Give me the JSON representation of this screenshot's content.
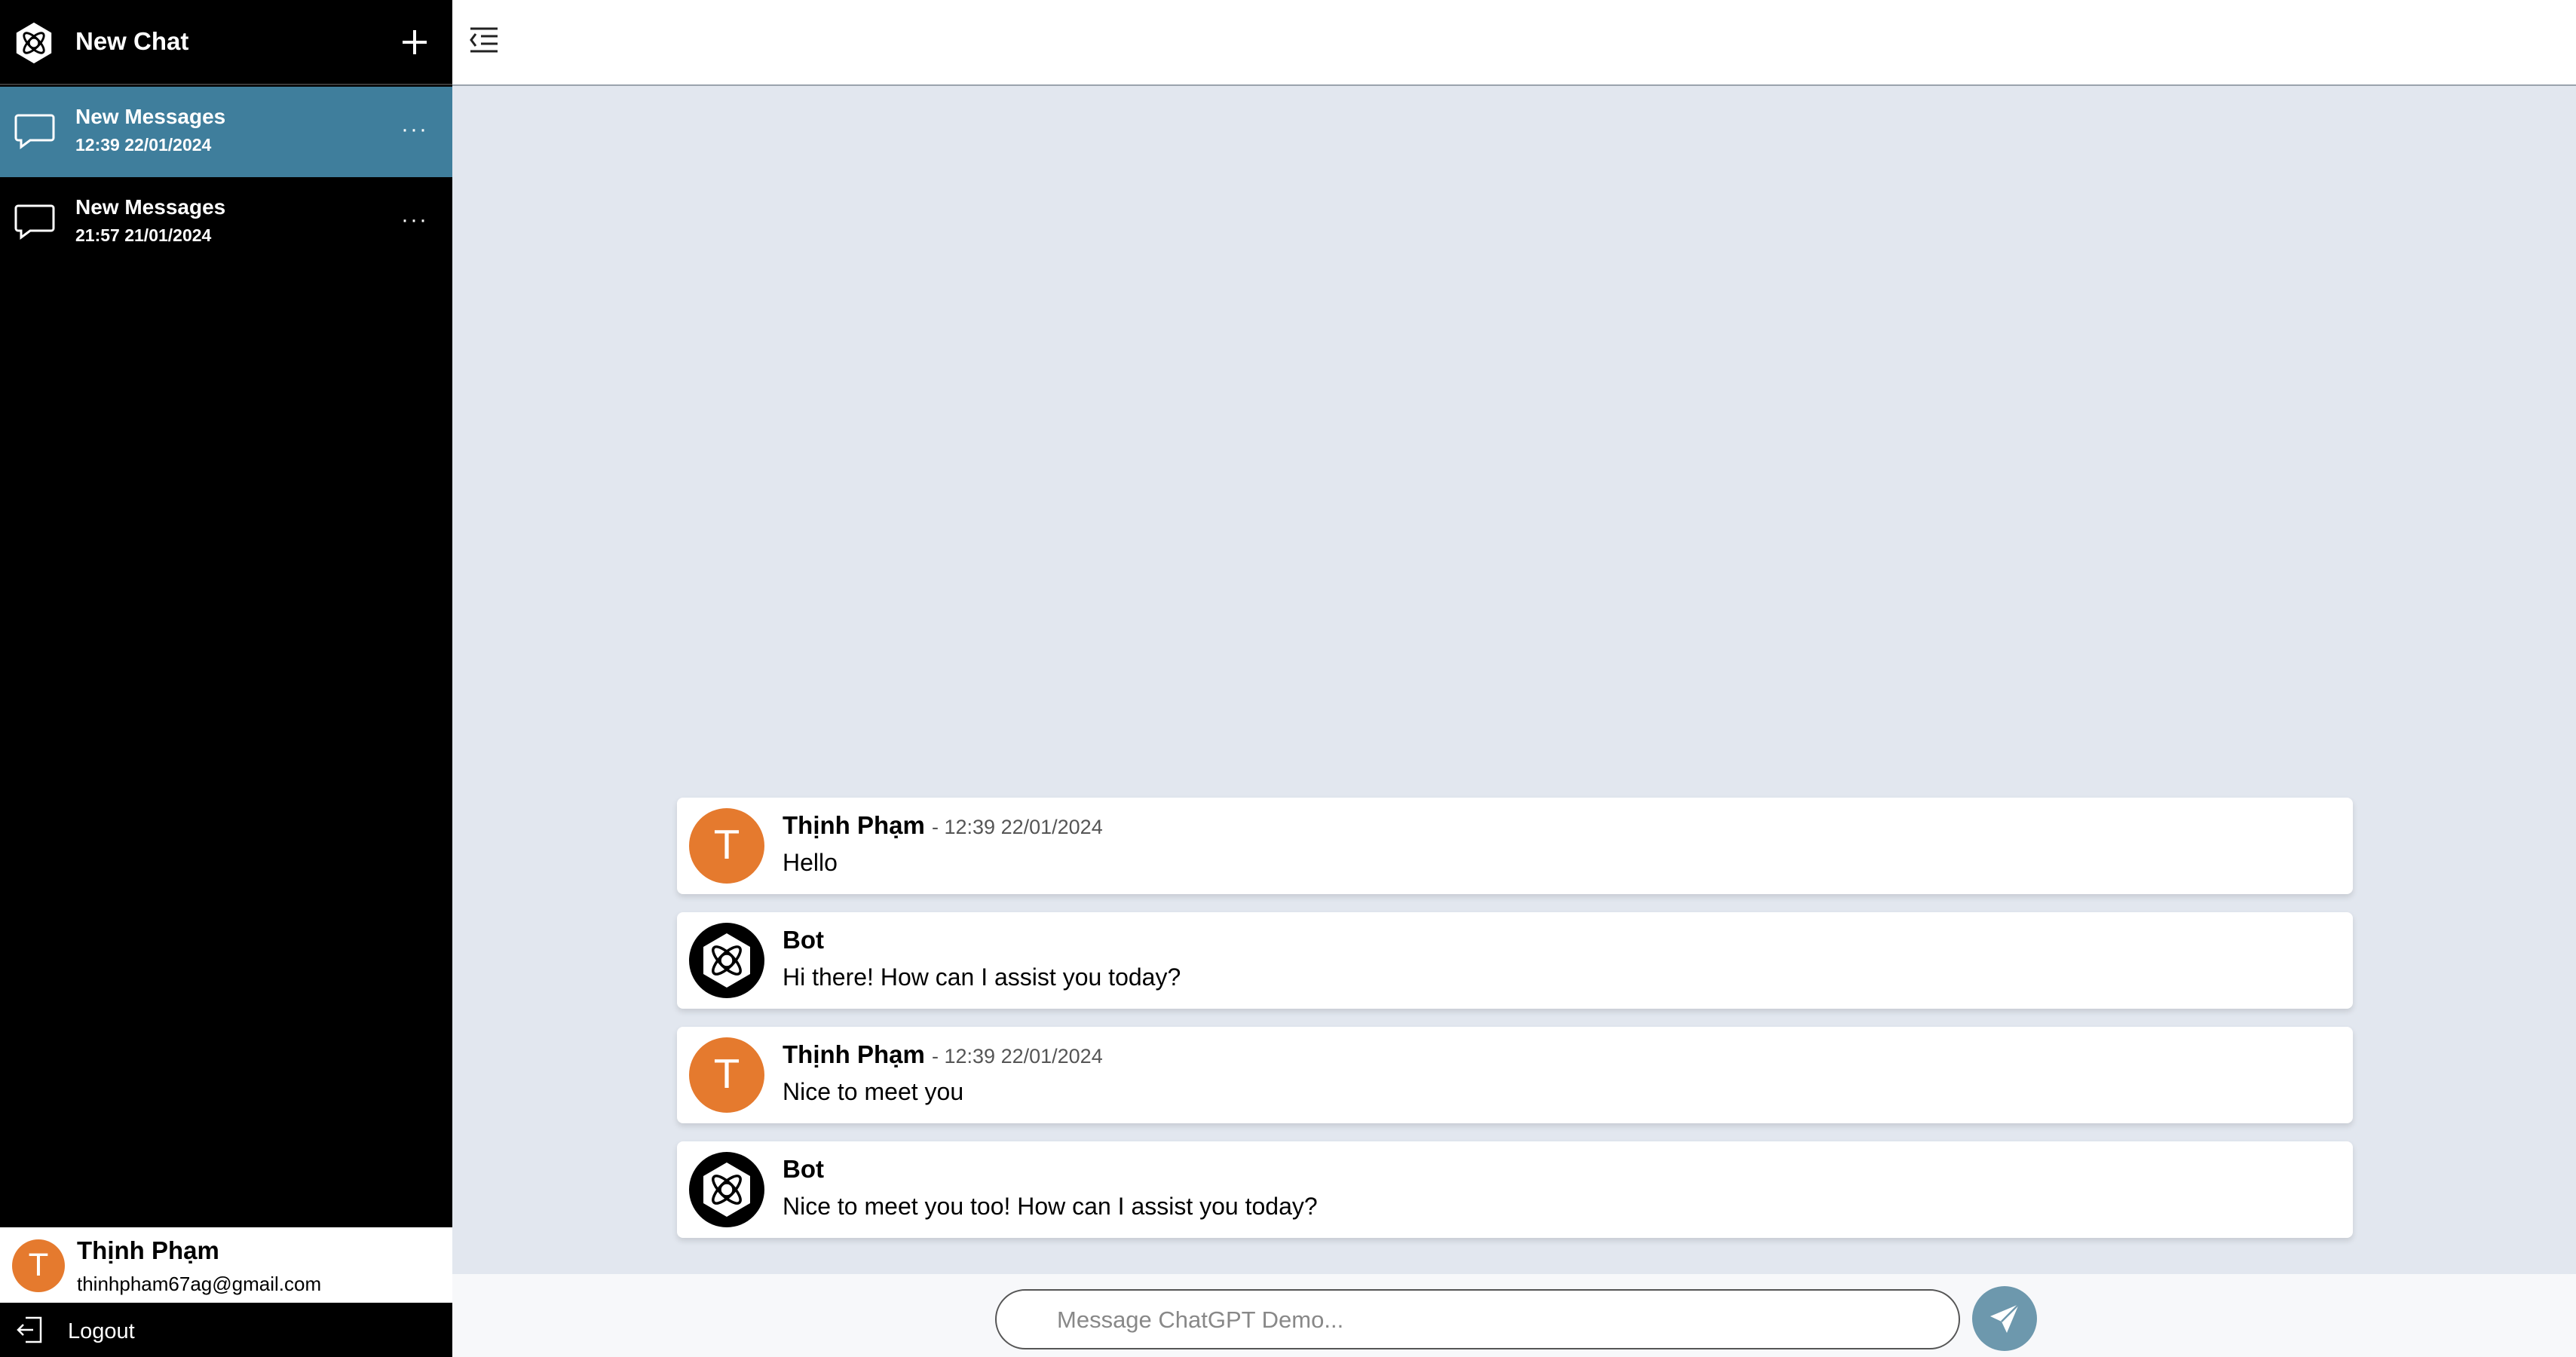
{
  "sidebar": {
    "title": "New Chat",
    "conversations": [
      {
        "title": "New Messages",
        "time": "12:39 22/01/2024",
        "active": true
      },
      {
        "title": "New Messages",
        "time": "21:57 21/01/2024",
        "active": false
      }
    ],
    "more_glyph": "···",
    "user": {
      "initial": "T",
      "name": "Thịnh Phạm",
      "email": "thinhpham67ag@gmail.com"
    },
    "logout_label": "Logout"
  },
  "messages": [
    {
      "author": "Thịnh Phạm",
      "time": "- 12:39 22/01/2024",
      "text": "Hello",
      "avatar": "T"
    },
    {
      "author": "Bot",
      "time": "",
      "text": "Hi there! How can I assist you today?",
      "avatar": "bot-logo-icon"
    },
    {
      "author": "Thịnh Phạm",
      "time": "- 12:39 22/01/2024",
      "text": "Nice to meet you",
      "avatar": "T"
    },
    {
      "author": "Bot",
      "time": "",
      "text": "Nice to meet you too! How can I assist you today?",
      "avatar": "bot-logo-icon"
    }
  ],
  "composer": {
    "placeholder": "Message ChatGPT Demo..."
  },
  "colors": {
    "active_conversation": "#3f7e9c",
    "avatar": "#e57a2e",
    "send_button": "#6d98ad",
    "chat_background": "#e2e7ef"
  }
}
